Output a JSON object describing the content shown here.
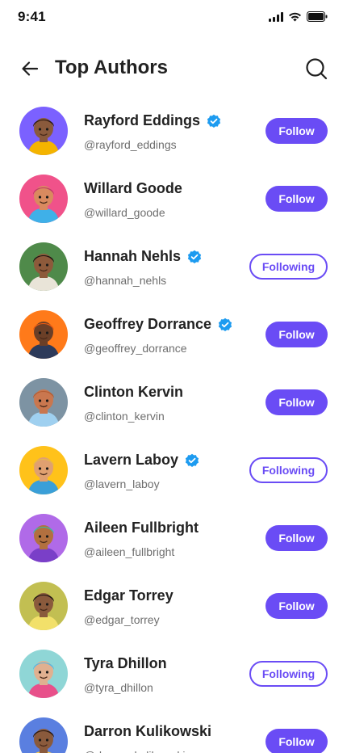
{
  "status_bar": {
    "time": "9:41"
  },
  "header": {
    "title": "Top Authors"
  },
  "colors": {
    "accent": "#6a4cf5",
    "verified": "#1d9bf0"
  },
  "authors": [
    {
      "name": "Rayford Eddings",
      "handle": "@rayford_eddings",
      "verified": true,
      "button": "Follow",
      "following": false,
      "avatar_bg": "#7b61ff",
      "skin": "#8a5a3c",
      "hair": "#2b1a12",
      "shirt": "#f4b400"
    },
    {
      "name": "Willard Goode",
      "handle": "@willard_goode",
      "verified": false,
      "button": "Follow",
      "following": false,
      "avatar_bg": "#f0528a",
      "skin": "#d98a5f",
      "hair": "#c23a6b",
      "shirt": "#3fb0e8"
    },
    {
      "name": "Hannah Nehls",
      "handle": "@hannah_nehls",
      "verified": true,
      "button": "Following",
      "following": true,
      "avatar_bg": "#4f8a4a",
      "skin": "#8d5a3b",
      "hair": "#1e1512",
      "shirt": "#e9e4d8"
    },
    {
      "name": "Geoffrey Dorrance",
      "handle": "@geoffrey_dorrance",
      "verified": true,
      "button": "Follow",
      "following": false,
      "avatar_bg": "#ff7a1a",
      "skin": "#6b3f27",
      "hair": "#e85a12",
      "shirt": "#2d3a5a"
    },
    {
      "name": "Clinton Kervin",
      "handle": "@clinton_kervin",
      "verified": false,
      "button": "Follow",
      "following": false,
      "avatar_bg": "#7d93a3",
      "skin": "#c9774f",
      "hair": "#b55d33",
      "shirt": "#9fd0f0"
    },
    {
      "name": "Lavern Laboy",
      "handle": "@lavern_laboy",
      "verified": true,
      "button": "Following",
      "following": true,
      "avatar_bg": "#ffc21a",
      "skin": "#e0a070",
      "hair": "#e6b84a",
      "shirt": "#3a9fd8"
    },
    {
      "name": "Aileen Fullbright",
      "handle": "@aileen_fullbright",
      "verified": false,
      "button": "Follow",
      "following": false,
      "avatar_bg": "#b06ae8",
      "skin": "#b2703f",
      "hair": "#3ab8a8",
      "shirt": "#7a3fc8"
    },
    {
      "name": "Edgar Torrey",
      "handle": "@edgar_torrey",
      "verified": false,
      "button": "Follow",
      "following": false,
      "avatar_bg": "#c2bf52",
      "skin": "#8a5a3c",
      "hair": "#1e1512",
      "shirt": "#f2e06a"
    },
    {
      "name": "Tyra Dhillon",
      "handle": "@tyra_dhillon",
      "verified": false,
      "button": "Following",
      "following": true,
      "avatar_bg": "#8fd6d6",
      "skin": "#e0b090",
      "hair": "#5ab8e0",
      "shirt": "#e8508a"
    },
    {
      "name": "Darron Kulikowski",
      "handle": "@darron_kulikowski",
      "verified": false,
      "button": "Follow",
      "following": false,
      "avatar_bg": "#5a7fe0",
      "skin": "#8a5a3c",
      "hair": "#2b1a12",
      "shirt": "#f2c94a"
    }
  ]
}
